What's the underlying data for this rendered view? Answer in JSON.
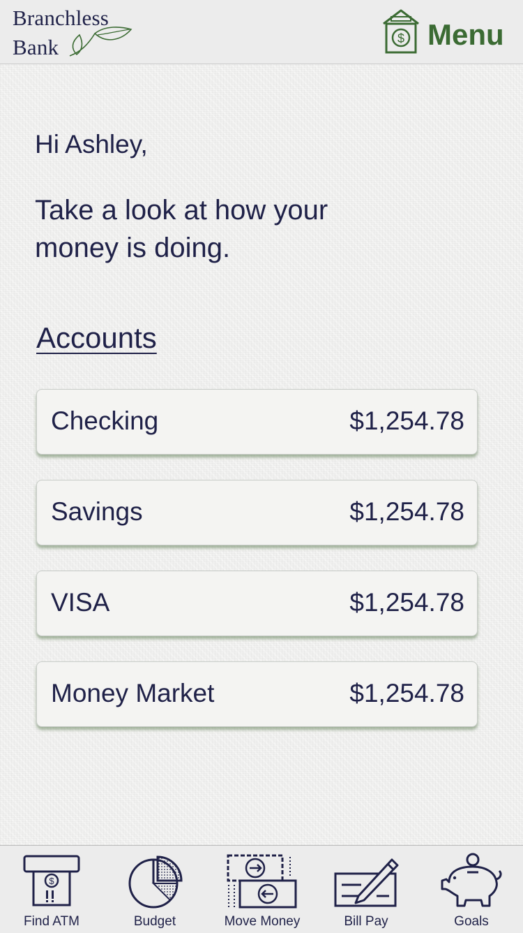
{
  "header": {
    "logo_line1": "Branchless",
    "logo_line2": "Bank",
    "menu_label": "Menu",
    "brand_green": "#3b6b33",
    "brand_navy": "#1f2148"
  },
  "greeting": {
    "hello": "Hi Ashley,",
    "line1": "Take a look at how your",
    "line2": "money is doing."
  },
  "accounts": {
    "heading": "Accounts",
    "items": [
      {
        "name": "Checking",
        "balance": "$1,254.78"
      },
      {
        "name": "Savings",
        "balance": "$1,254.78"
      },
      {
        "name": "VISA",
        "balance": "$1,254.78"
      },
      {
        "name": "Money Market",
        "balance": "$1,254.78"
      }
    ]
  },
  "tabbar": {
    "items": [
      {
        "label": "Find ATM",
        "icon": "atm-icon"
      },
      {
        "label": "Budget",
        "icon": "pie-chart-icon"
      },
      {
        "label": "Move Money",
        "icon": "transfer-icon"
      },
      {
        "label": "Bill Pay",
        "icon": "check-pen-icon"
      },
      {
        "label": "Goals",
        "icon": "piggy-bank-icon"
      }
    ]
  }
}
